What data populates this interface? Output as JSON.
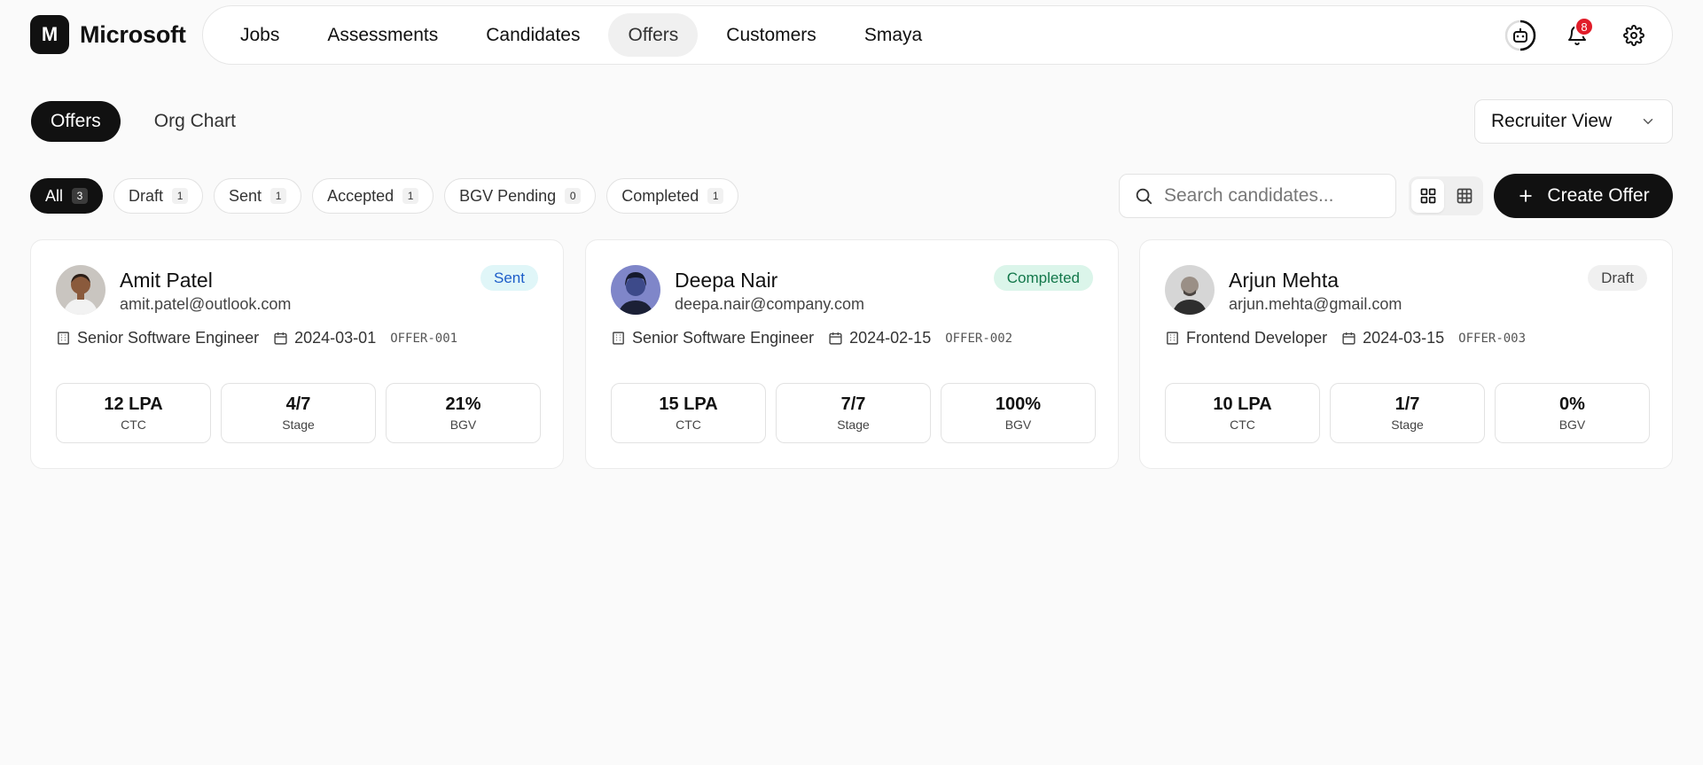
{
  "brand": {
    "initial": "M",
    "name": "Microsoft"
  },
  "nav": {
    "items": [
      {
        "label": "Jobs",
        "active": false
      },
      {
        "label": "Assessments",
        "active": false
      },
      {
        "label": "Candidates",
        "active": false
      },
      {
        "label": "Offers",
        "active": true
      },
      {
        "label": "Customers",
        "active": false
      },
      {
        "label": "Smaya",
        "active": false
      }
    ],
    "icons": [
      "bot-icon",
      "bell-icon",
      "gear-icon"
    ],
    "notification_count": "8"
  },
  "tabs": [
    {
      "label": "Offers",
      "active": true
    },
    {
      "label": "Org Chart",
      "active": false
    }
  ],
  "view_select": {
    "value": "Recruiter View"
  },
  "filters": [
    {
      "label": "All",
      "count": "3",
      "active": true
    },
    {
      "label": "Draft",
      "count": "1",
      "active": false
    },
    {
      "label": "Sent",
      "count": "1",
      "active": false
    },
    {
      "label": "Accepted",
      "count": "1",
      "active": false
    },
    {
      "label": "BGV Pending",
      "count": "0",
      "active": false
    },
    {
      "label": "Completed",
      "count": "1",
      "active": false
    }
  ],
  "search": {
    "placeholder": "Search candidates..."
  },
  "create_button": {
    "label": "Create Offer"
  },
  "stat_labels": {
    "ctc": "CTC",
    "stage": "Stage",
    "bgv": "BGV"
  },
  "offers": [
    {
      "name": "Amit Patel",
      "email": "amit.patel@outlook.com",
      "status": "Sent",
      "role": "Senior Software Engineer",
      "date": "2024-03-01",
      "offer_id": "OFFER-001",
      "ctc": "12 LPA",
      "stage": "4/7",
      "bgv": "21%"
    },
    {
      "name": "Deepa Nair",
      "email": "deepa.nair@company.com",
      "status": "Completed",
      "role": "Senior Software Engineer",
      "date": "2024-02-15",
      "offer_id": "OFFER-002",
      "ctc": "15 LPA",
      "stage": "7/7",
      "bgv": "100%"
    },
    {
      "name": "Arjun Mehta",
      "email": "arjun.mehta@gmail.com",
      "status": "Draft",
      "role": "Frontend Developer",
      "date": "2024-03-15",
      "offer_id": "OFFER-003",
      "ctc": "10 LPA",
      "stage": "1/7",
      "bgv": "0%"
    }
  ]
}
